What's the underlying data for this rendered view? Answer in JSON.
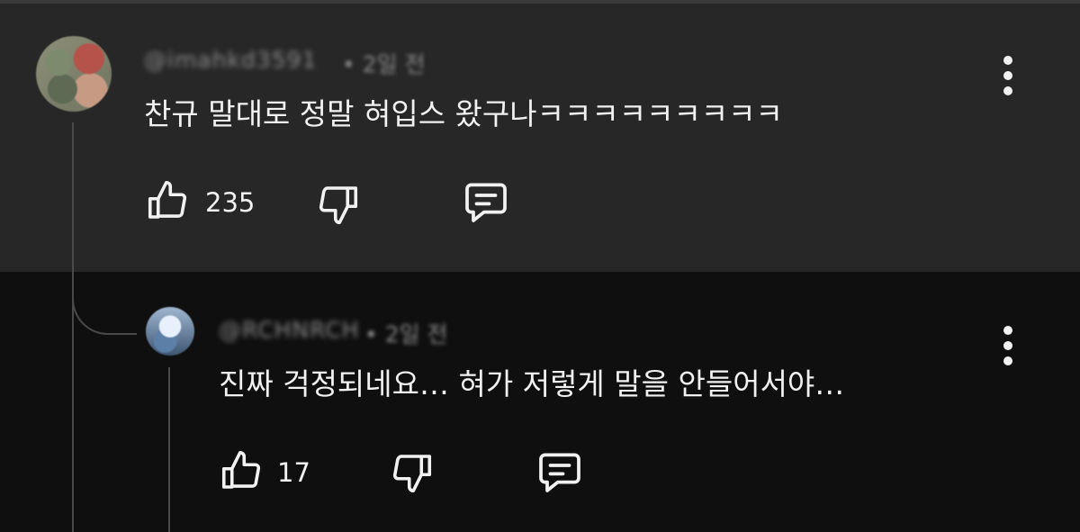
{
  "comment": {
    "username": "@imahkd3591",
    "meta": "• 2일 전",
    "text": "찬규 말대로 정말 혀입스 왔구나ㅋㅋㅋㅋㅋㅋㅋㅋㅋ",
    "like_count": "235",
    "icons": [
      "thumbs-up-icon",
      "thumbs-down-icon",
      "reply-icon",
      "more-vert-icon"
    ]
  },
  "reply": {
    "username": "@RCHNRCH",
    "meta": "• 2일 전",
    "text": "진짜 걱정되네요… 혀가 저렇게 말을 안들어서야…",
    "like_count": "17",
    "icons": [
      "thumbs-up-icon",
      "thumbs-down-icon",
      "reply-icon",
      "more-vert-icon"
    ]
  },
  "colors": {
    "top_bg": "#272727",
    "page_bg": "#0f0f0f",
    "text": "#f1f1f1",
    "meta": "#8a8a8a"
  }
}
